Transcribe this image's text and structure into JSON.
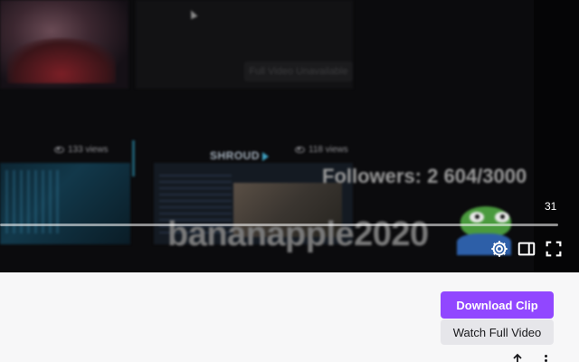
{
  "player": {
    "overlay_unavailable": "Full Video Unavailable",
    "clips": [
      {
        "views": "133 views"
      },
      {
        "views": "118 views"
      }
    ],
    "channel_overlay_logo": "SHROUD",
    "followers_overlay": "Followers: 2 604/3000",
    "username_overlay": "bananapple2020",
    "timestamp": "31",
    "progress_fraction": 0.99,
    "icons": {
      "settings": "gear-icon",
      "theatre": "theatre-mode-icon",
      "fullscreen": "fullscreen-icon"
    }
  },
  "actions": {
    "download_label": "Download Clip",
    "watch_label": "Watch Full Video",
    "share_icon": "share-icon",
    "more_icon": "more-options-icon"
  },
  "colors": {
    "accent": "#9147ff",
    "secondary_button": "#e6e6ea",
    "page_background": "#f7f7f8",
    "player_background": "#0b0b0d"
  }
}
